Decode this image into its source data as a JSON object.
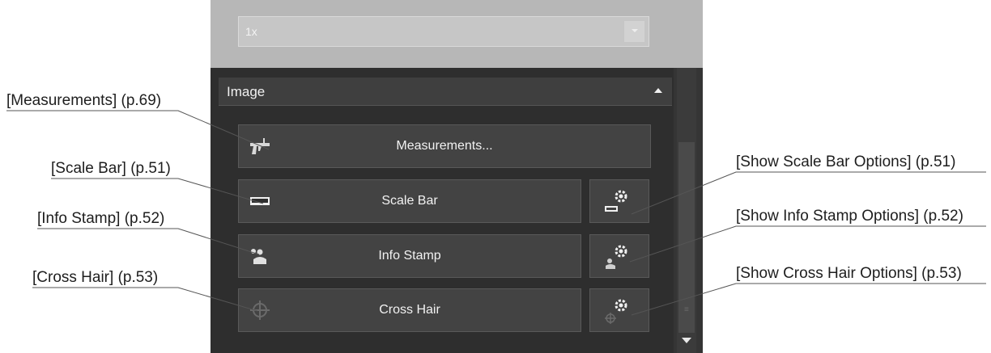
{
  "zoom": {
    "value": "1x"
  },
  "section": {
    "title": "Image"
  },
  "buttons": {
    "measurements": "Measurements...",
    "scale_bar": "Scale Bar",
    "info_stamp": "Info Stamp",
    "cross_hair": "Cross Hair"
  },
  "callouts": {
    "measurements": "[Measurements] (p.69)",
    "scale_bar": "[Scale Bar] (p.51)",
    "info_stamp": "[Info Stamp] (p.52)",
    "cross_hair": "[Cross Hair] (p.53)",
    "scale_bar_options": "[Show Scale Bar Options] (p.51)",
    "info_stamp_options": "[Show Info Stamp Options] (p.52)",
    "cross_hair_options": "[Show Cross Hair Options] (p.53)"
  },
  "icons": {
    "measurements": "caliper-icon",
    "scale_bar": "scale-bar-icon",
    "info_stamp": "info-stamp-icon",
    "cross_hair": "crosshair-icon",
    "options": "gear-icon",
    "collapse": "chevron-up-icon",
    "dropdown": "chevron-down-icon"
  },
  "colors": {
    "panel": "#2e2e2e",
    "button": "#434343",
    "top_area": "#b7b7b7"
  }
}
